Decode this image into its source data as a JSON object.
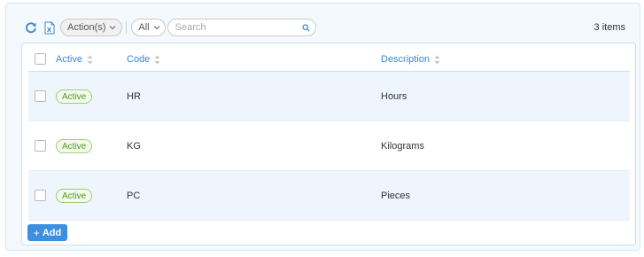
{
  "toolbar": {
    "actions_label": "Action(s)",
    "filter_value": "All",
    "search_placeholder": "Search",
    "item_count": "3 items"
  },
  "table": {
    "columns": [
      "Active",
      "Code",
      "Description"
    ],
    "rows": [
      {
        "active": "Active",
        "code": "HR",
        "description": "Hours"
      },
      {
        "active": "Active",
        "code": "KG",
        "description": "Kilograms"
      },
      {
        "active": "Active",
        "code": "PC",
        "description": "Pieces"
      }
    ]
  },
  "add_label": "Add",
  "colors": {
    "accent": "#3a86d8",
    "button": "#3d8fe0",
    "badge_text": "#4e9a2a",
    "badge_border": "#9ad07a",
    "row_highlight": "#eef5fc"
  }
}
